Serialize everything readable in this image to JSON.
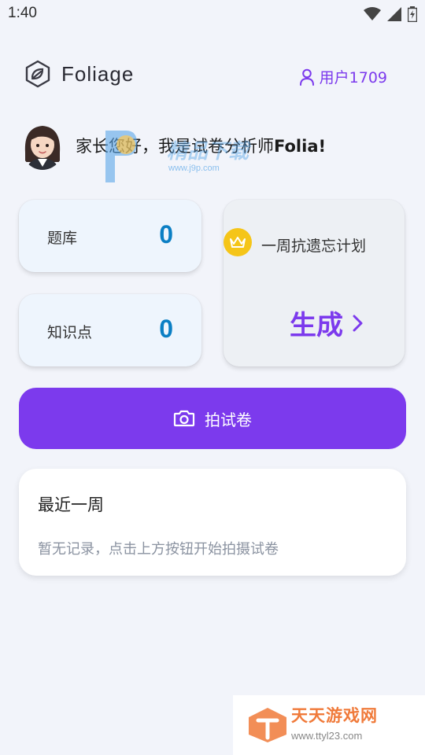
{
  "status": {
    "time": "1:40"
  },
  "header": {
    "brand": "Foliage",
    "user_label": "用户1709"
  },
  "greeting": {
    "prefix": "家长您好，我是试卷分析师",
    "name": "Folia",
    "suffix": "!"
  },
  "stats": [
    {
      "label": "题库",
      "value": "0"
    },
    {
      "label": "知识点",
      "value": "0"
    }
  ],
  "plan": {
    "title": "一周抗遗忘计划",
    "action": "生成"
  },
  "shoot_button": {
    "label": "拍试卷"
  },
  "recent": {
    "title": "最近一周",
    "empty": "暂无记录，点击上方按钮开始拍摄试卷"
  },
  "watermarks": {
    "center_text": "精品下载",
    "center_url": "www.j9p.com",
    "corner_text": "天天游戏网",
    "corner_url": "www.ttyl23.com"
  },
  "colors": {
    "accent": "#7C3AED",
    "stat_value": "#0B7FC4",
    "background": "#F2F4FA"
  }
}
